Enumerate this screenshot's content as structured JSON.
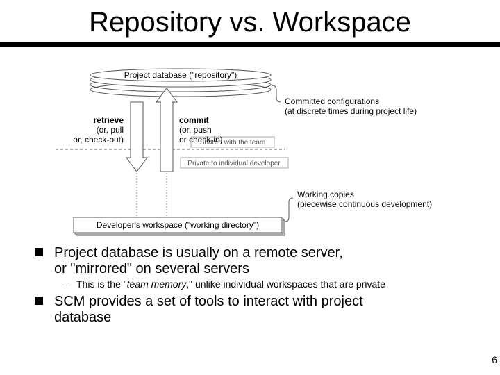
{
  "title": "Repository vs. Workspace",
  "diagram": {
    "repo_label": "Project database (\"repository\")",
    "arrow_left_label": "retrieve",
    "arrow_left_sub1": "(or, pull",
    "arrow_left_sub2": "or, check-out)",
    "arrow_right_label": "commit",
    "arrow_right_sub1": "(or, push",
    "arrow_right_sub2": "or check-in)",
    "shared_label": "Shared with the team",
    "private_label": "Private to individual developer",
    "workspace_label": "Developer's workspace (\"working directory\")"
  },
  "caption1_line1": "Committed configurations",
  "caption1_line2": "(at discrete times during project life)",
  "caption2_line1": "Working copies",
  "caption2_line2": "(piecewise continuous development)",
  "bullets": {
    "b1_line1": "Project database is usually on a remote server,",
    "b1_line2": "or \"mirrored\" on several servers",
    "b1_sub_pre": "This is the \"",
    "b1_sub_em": "team memory",
    "b1_sub_post": ",\" unlike individual workspaces that are private",
    "b2_line1": "SCM provides a set of tools to interact with project",
    "b2_line2": "database"
  },
  "page_number": "6"
}
